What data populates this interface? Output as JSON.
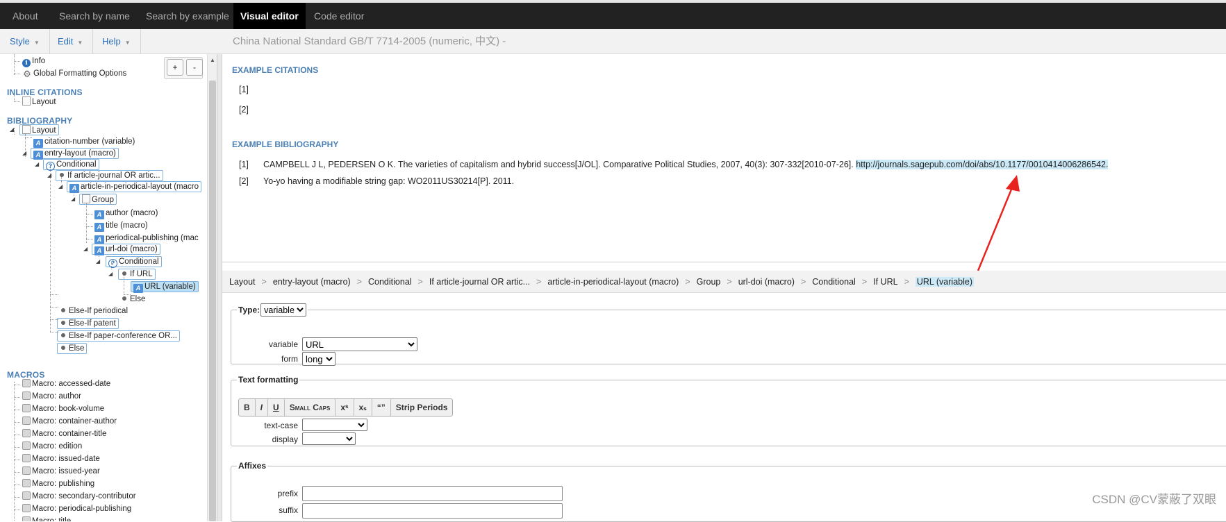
{
  "nav": {
    "tabs": [
      "About",
      "Search by name",
      "Search by example",
      "Visual editor",
      "Code editor"
    ],
    "active": "Visual editor"
  },
  "menu": {
    "style": "Style",
    "edit": "Edit",
    "help": "Help"
  },
  "style_title": "China National Standard GB/T 7714-2005 (numeric, 中文) -",
  "tree": {
    "info": "Info",
    "global": "Global Formatting Options",
    "plus": "+",
    "minus": "-",
    "inline_head": "INLINE CITATIONS",
    "inline_layout": "Layout",
    "bib_head": "BIBLIOGRAPHY",
    "bib_layout": "Layout",
    "citation_number": "citation-number (variable)",
    "entry_layout": "entry-layout (macro)",
    "conditional1": "Conditional",
    "if_article": "If article-journal OR artic...",
    "article_periodical": "article-in-periodical-layout (macro",
    "group": "Group",
    "author": "author (macro)",
    "title": "title (macro)",
    "periodical_publishing": "periodical-publishing (mac",
    "url_doi": "url-doi (macro)",
    "conditional2": "Conditional",
    "if_url": "If URL",
    "url_variable": "URL (variable)",
    "else_inner": "Else",
    "elseif_periodical": "Else-If periodical",
    "elseif_patent": "Else-If patent",
    "elseif_paper": "Else-If paper-conference OR...",
    "else_outer": "Else",
    "macros_head": "MACROS",
    "macros": [
      "Macro: accessed-date",
      "Macro: author",
      "Macro: book-volume",
      "Macro: container-author",
      "Macro: container-title",
      "Macro: edition",
      "Macro: issued-date",
      "Macro: issued-year",
      "Macro: publishing",
      "Macro: secondary-contributor",
      "Macro: periodical-publishing",
      "Macro: title"
    ]
  },
  "examples": {
    "citations_head": "EXAMPLE CITATIONS",
    "citations": [
      "[1]",
      "[2]"
    ],
    "bib_head": "EXAMPLE BIBLIOGRAPHY",
    "bib": [
      {
        "num": "[1]",
        "text": "CAMPBELL J L, PEDERSEN O K. The varieties of capitalism and hybrid success[J/OL]. Comparative Political Studies, 2007, 40(3): 307-332[2010-07-26].",
        "url": "http://journals.sagepub.com/doi/abs/10.1177/0010414006286542."
      },
      {
        "num": "[2]",
        "text": "Yo-yo having a modifiable string gap: WO2011US30214[P]. 2011.",
        "url": ""
      }
    ]
  },
  "breadcrumb": [
    "Layout",
    "entry-layout (macro)",
    "Conditional",
    "If article-journal OR artic...",
    "article-in-periodical-layout (macro)",
    "Group",
    "url-doi (macro)",
    "Conditional",
    "If URL",
    "URL (variable)"
  ],
  "editor": {
    "type_legend": "Type:",
    "type_value": "variable",
    "variable_label": "variable",
    "variable_value": "URL",
    "form_label": "form",
    "form_value": "long",
    "text_formatting_legend": "Text formatting",
    "fmt_buttons": [
      "B",
      "I",
      "U",
      "Small Caps",
      "xˢ",
      "xₛ",
      "“”",
      "Strip Periods"
    ],
    "text_case_label": "text-case",
    "display_label": "display",
    "affixes_legend": "Affixes",
    "prefix_label": "prefix",
    "suffix_label": "suffix",
    "prefix_value": "",
    "suffix_value": ""
  },
  "watermark": "CSDN @CV蒙蔽了双眼",
  "colors": {
    "accent": "#4a7fb5",
    "selected": "#bde0f5",
    "arrow": "#e8231f"
  }
}
